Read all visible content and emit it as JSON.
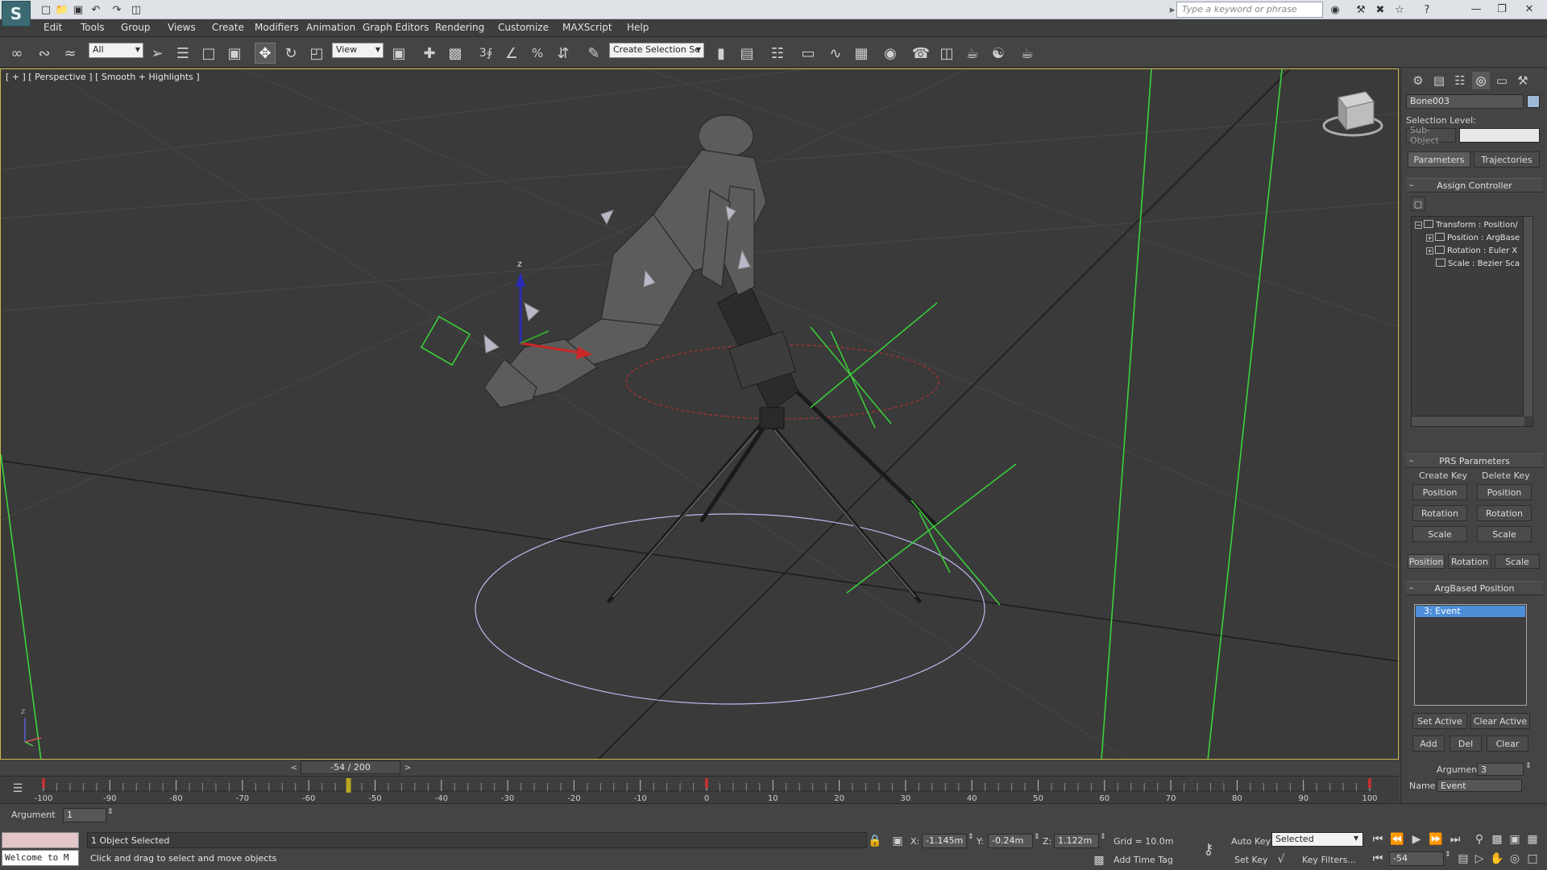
{
  "titlebar": {
    "logo": "S",
    "search_placeholder": "Type a keyword or phrase"
  },
  "menu": [
    "Edit",
    "Tools",
    "Group",
    "Views",
    "Create",
    "Modifiers",
    "Animation",
    "Graph Editors",
    "Rendering",
    "Customize",
    "MAXScript",
    "Help"
  ],
  "toolbar": {
    "selection_filter": "All",
    "reference_coord": "View",
    "snap_3": "3",
    "named_selection": "Create Selection Se"
  },
  "viewport": {
    "label": "[ + ] [ Perspective ] [ Smooth + Highlights ]",
    "gizmo_z": "z",
    "axis_tripod_z": "z"
  },
  "command_panel": {
    "object_name": "Bone003",
    "selection_level_label": "Selection Level:",
    "sub_object_label": "Sub-Object",
    "tabs": [
      "Parameters",
      "Trajectories"
    ],
    "assign_controller_title": "Assign Controller",
    "tree": [
      {
        "label": "Transform : Position/",
        "expander": "−"
      },
      {
        "label": "Position : ArgBase",
        "expander": "+"
      },
      {
        "label": "Rotation : Euler X",
        "expander": "+"
      },
      {
        "label": "Scale : Bezier Sca",
        "expander": ""
      }
    ],
    "prs_title": "PRS Parameters",
    "create_key_label": "Create Key",
    "delete_key_label": "Delete Key",
    "create_key_buttons": [
      "Position",
      "Rotation",
      "Scale"
    ],
    "delete_key_buttons": [
      "Position",
      "Rotation",
      "Scale"
    ],
    "prs_tabs": [
      "Position",
      "Rotation",
      "Scale"
    ],
    "argbased_title": "ArgBased Position",
    "events": [
      "3: Event"
    ],
    "set_active": "Set Active",
    "clear_active": "Clear Active",
    "add": "Add",
    "del": "Del",
    "clear": "Clear",
    "argument_label": "Argument",
    "argument_value": "3",
    "name_label": "Name",
    "name_value": "Event"
  },
  "timeslider": {
    "frame_display": "-54 / 200",
    "current_frame": -54,
    "range": [
      -100,
      100
    ]
  },
  "trackbar": {
    "ticks": [
      -100,
      -90,
      -80,
      -70,
      -60,
      -50,
      -40,
      -30,
      -20,
      -10,
      0,
      10,
      20,
      30,
      40,
      50,
      60,
      70,
      80,
      90,
      100
    ]
  },
  "status": {
    "argument_label": "Argument",
    "argument_value": "1",
    "welcome": "Welcome to M",
    "selection_status": "1 Object Selected",
    "prompt": "Click and drag to select and move objects",
    "x_label": "X:",
    "x_value": "-1.145m",
    "y_label": "Y:",
    "y_value": "-0.24m",
    "z_label": "Z:",
    "z_value": "1.122m",
    "grid": "Grid = 10.0m",
    "add_time_tag": "Add Time Tag",
    "auto_key": "Auto Key",
    "set_key": "Set Key",
    "key_mode": "Selected",
    "key_filters": "Key Filters...",
    "frame_field": "-54"
  },
  "colors": {
    "viewport_border": "#c8b64a",
    "selection_blue": "#4d8ed8",
    "helper_green": "#3ad23a"
  }
}
